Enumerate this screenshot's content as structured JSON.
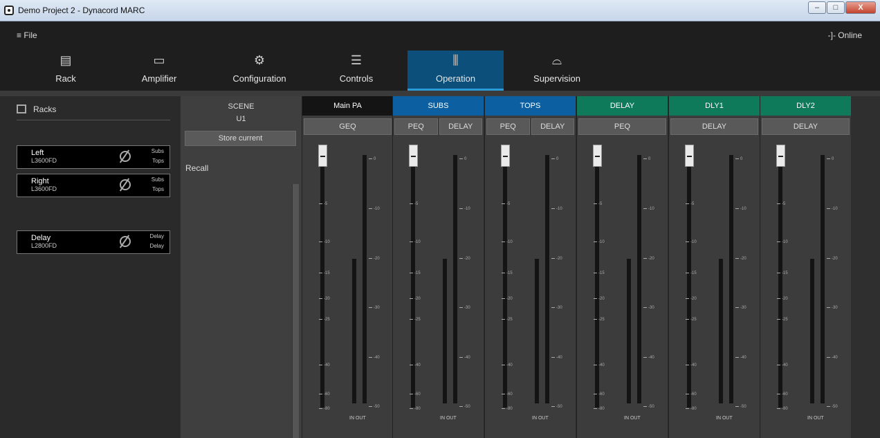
{
  "window": {
    "title": "Demo Project 2 - Dynacord MARC",
    "buttons": [
      "–",
      "□",
      "X"
    ]
  },
  "menu": {
    "file": "≡ File",
    "status": "-]- Online"
  },
  "tabs": [
    {
      "label": "Rack",
      "icon": "rack-icon"
    },
    {
      "label": "Amplifier",
      "icon": "amplifier-icon"
    },
    {
      "label": "Configuration",
      "icon": "gear-icon"
    },
    {
      "label": "Controls",
      "icon": "sliders-icon"
    },
    {
      "label": "Operation",
      "icon": "fader-icon",
      "active": true
    },
    {
      "label": "Supervision",
      "icon": "eye-icon"
    }
  ],
  "racks": {
    "header": "Racks",
    "items": [
      {
        "name": "Left",
        "model": "L3600FD",
        "out1": "Subs",
        "out2": "Tops"
      },
      {
        "name": "Right",
        "model": "L3600FD",
        "out1": "Subs",
        "out2": "Tops"
      },
      {
        "name": "Delay",
        "model": "L2800FD",
        "out1": "Delay",
        "out2": "Delay"
      }
    ]
  },
  "scene": {
    "title": "SCENE",
    "current": "U1",
    "store": "Store current",
    "recall": "Recall"
  },
  "channels": [
    {
      "name": "Main PA",
      "color": "#141414",
      "buttons": [
        "GEQ"
      ]
    },
    {
      "name": "SUBS",
      "color": "#0c5fa0",
      "buttons": [
        "PEQ",
        "DELAY"
      ]
    },
    {
      "name": "TOPS",
      "color": "#0c5fa0",
      "buttons": [
        "PEQ",
        "DELAY"
      ]
    },
    {
      "name": "DELAY",
      "color": "#0e7a5a",
      "buttons": [
        "PEQ"
      ]
    },
    {
      "name": "DLY1",
      "color": "#0e7a5a",
      "buttons": [
        "DELAY"
      ]
    },
    {
      "name": "DLY2",
      "color": "#0e7a5a",
      "buttons": [
        "DELAY"
      ]
    }
  ],
  "fader_scale": [
    "0",
    "-5",
    "-10",
    "-15",
    "-20",
    "-25",
    "-40",
    "-60",
    "-80"
  ],
  "meter_scale": [
    "0",
    "-10",
    "-20",
    "-30",
    "-40",
    "-50"
  ],
  "meter_labels": {
    "in": "IN",
    "out": "OUT"
  },
  "fader_level_db": 0,
  "meter_in_fraction": 0.57,
  "meter_out_fraction": 0.98
}
